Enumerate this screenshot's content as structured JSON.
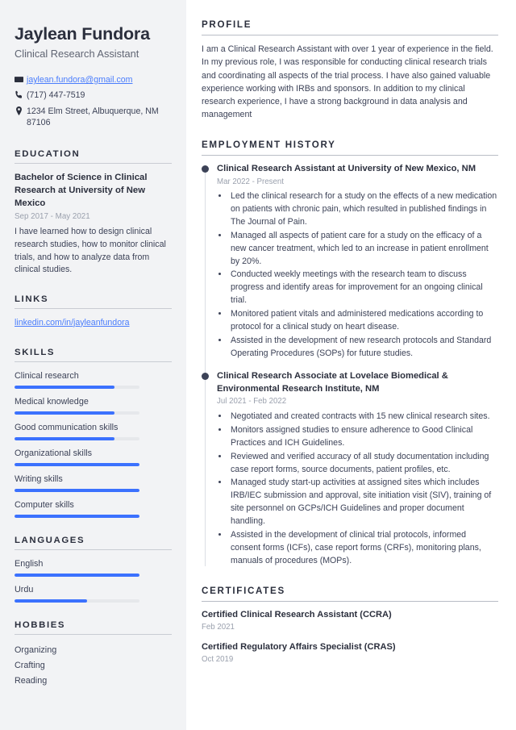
{
  "theme": {
    "sidebar_bg": "#f2f3f5",
    "accent": "#3b71fe",
    "link": "#4a7dfd",
    "heading": "#2b2f3d",
    "body_text": "#3c4257",
    "muted": "#9aa0ad"
  },
  "header": {
    "name": "Jaylean Fundora",
    "title": "Clinical Research Assistant"
  },
  "contact": {
    "email": "jaylean.fundora@gmail.com",
    "phone": "(717) 447-7519",
    "address": "1234 Elm Street, Albuquerque, NM 87106"
  },
  "sidebar": {
    "education": {
      "heading": "EDUCATION",
      "items": [
        {
          "title": "Bachelor of Science in Clinical Research at University of New Mexico",
          "date": "Sep 2017 - May 2021",
          "description": "I have learned how to design clinical research studies, how to monitor clinical trials, and how to analyze data from clinical studies."
        }
      ]
    },
    "links": {
      "heading": "LINKS",
      "items": [
        {
          "label": "linkedin.com/in/jayleanfundora"
        }
      ]
    },
    "skills": {
      "heading": "SKILLS",
      "items": [
        {
          "label": "Clinical research",
          "level": 80
        },
        {
          "label": "Medical knowledge",
          "level": 80
        },
        {
          "label": "Good communication skills",
          "level": 80
        },
        {
          "label": "Organizational skills",
          "level": 100
        },
        {
          "label": "Writing skills",
          "level": 100
        },
        {
          "label": "Computer skills",
          "level": 100
        }
      ]
    },
    "languages": {
      "heading": "LANGUAGES",
      "items": [
        {
          "label": "English",
          "level": 100
        },
        {
          "label": "Urdu",
          "level": 58
        }
      ]
    },
    "hobbies": {
      "heading": "HOBBIES",
      "items": [
        {
          "label": "Organizing"
        },
        {
          "label": "Crafting"
        },
        {
          "label": "Reading"
        }
      ]
    }
  },
  "main": {
    "profile": {
      "heading": "PROFILE",
      "text": "I am a Clinical Research Assistant with over 1 year of experience in the field. In my previous role, I was responsible for conducting clinical research trials and coordinating all aspects of the trial process. I have also gained valuable experience working with IRBs and sponsors. In addition to my clinical research experience, I have a strong background in data analysis and management"
    },
    "employment": {
      "heading": "EMPLOYMENT HISTORY",
      "jobs": [
        {
          "title": "Clinical Research Assistant at University of New Mexico, NM",
          "date": "Mar 2022 - Present",
          "bullets": [
            "Led the clinical research for a study on the effects of a new medication on patients with chronic pain, which resulted in published findings in The Journal of Pain.",
            "Managed all aspects of patient care for a study on the efficacy of a new cancer treatment, which led to an increase in patient enrollment by 20%.",
            "Conducted weekly meetings with the research team to discuss progress and identify areas for improvement for an ongoing clinical trial.",
            "Monitored patient vitals and administered medications according to protocol for a clinical study on heart disease.",
            "Assisted in the development of new research protocols and Standard Operating Procedures (SOPs) for future studies."
          ]
        },
        {
          "title": "Clinical Research Associate at Lovelace Biomedical & Environmental Research Institute, NM",
          "date": "Jul 2021 - Feb 2022",
          "bullets": [
            "Negotiated and created contracts with 15 new clinical research sites.",
            "Monitors assigned studies to ensure adherence to Good Clinical Practices and ICH Guidelines.",
            "Reviewed and verified accuracy of all study documentation including case report forms, source documents, patient profiles, etc.",
            "Managed study start-up activities at assigned sites which includes IRB/IEC submission and approval, site initiation visit (SIV), training of site personnel on GCPs/ICH Guidelines and proper document handling.",
            "Assisted in the development of clinical trial protocols, informed consent forms (ICFs), case report forms (CRFs), monitoring plans, manuals of procedures (MOPs)."
          ]
        }
      ]
    },
    "certificates": {
      "heading": "CERTIFICATES",
      "items": [
        {
          "name": "Certified Clinical Research Assistant (CCRA)",
          "date": "Feb 2021"
        },
        {
          "name": "Certified Regulatory Affairs Specialist (CRAS)",
          "date": "Oct 2019"
        }
      ]
    }
  }
}
